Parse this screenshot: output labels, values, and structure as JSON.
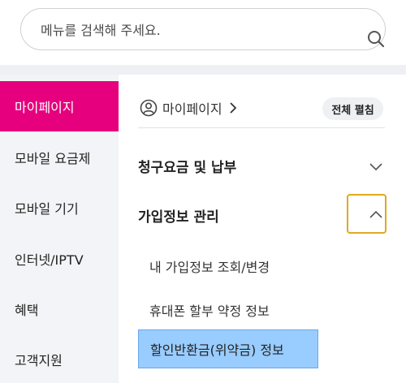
{
  "search": {
    "placeholder": "메뉴를 검색해 주세요."
  },
  "sidebar": {
    "items": [
      {
        "label": "마이페이지",
        "active": true
      },
      {
        "label": "모바일 요금제"
      },
      {
        "label": "모바일 기기"
      },
      {
        "label": "인터넷/IPTV"
      },
      {
        "label": "혜택"
      },
      {
        "label": "고객지원"
      }
    ]
  },
  "main": {
    "breadcrumb": "마이페이지",
    "expand_all_label": "전체 펼침",
    "sections": [
      {
        "label": "청구요금 및 납부",
        "expanded": false
      },
      {
        "label": "가입정보 관리",
        "expanded": true
      }
    ],
    "sub_items": [
      {
        "label": "내 가입정보 조회/변경"
      },
      {
        "label": "휴대폰 할부 약정 정보"
      },
      {
        "label": "할인반환금(위약금) 정보",
        "highlighted": true
      }
    ]
  },
  "colors": {
    "accent": "#e6007e",
    "highlight": "#99ccff",
    "focus_outline": "#e0a920",
    "sidebar_bg": "#f3f4f7"
  }
}
